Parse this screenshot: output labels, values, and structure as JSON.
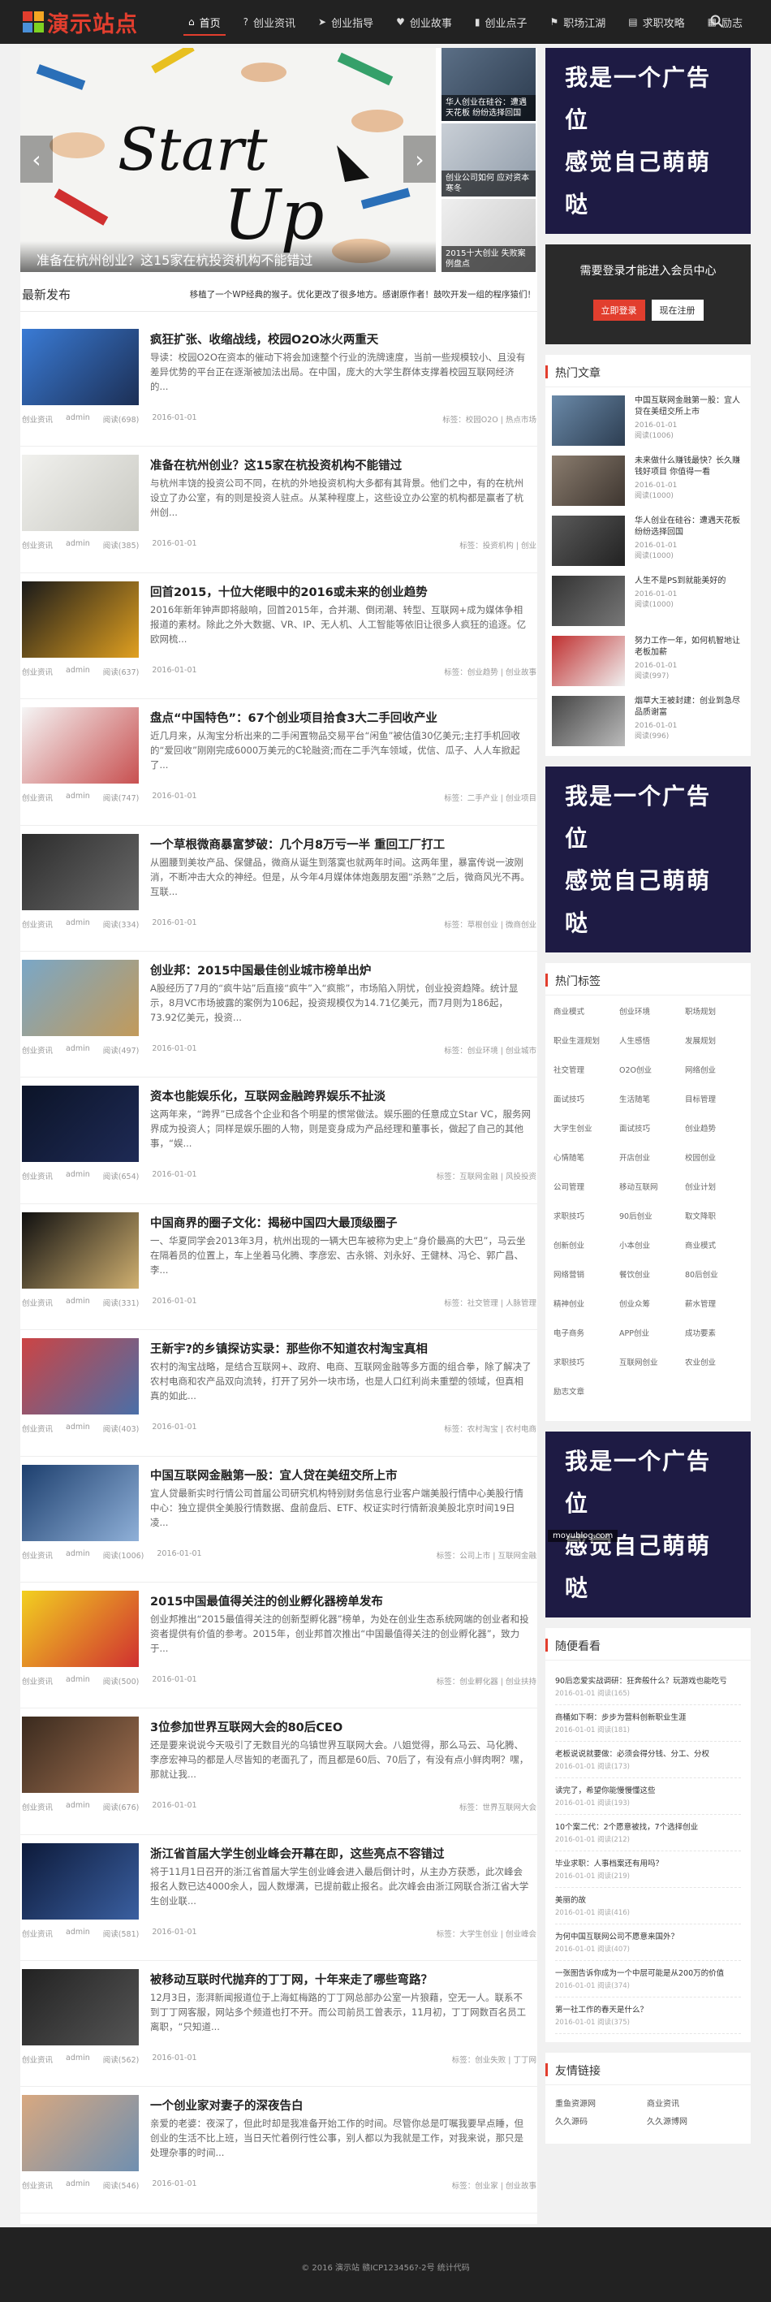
{
  "site": {
    "logo_text": "演示站点",
    "brand_colors": {
      "red": "#e23e2e",
      "orange": "#f5a623",
      "dark": "#222222",
      "ad": "#1e1b44"
    }
  },
  "nav": [
    {
      "label": "首页",
      "icon": "home-icon",
      "glyph": "⌂"
    },
    {
      "label": "创业资讯",
      "icon": "question-icon",
      "glyph": "?"
    },
    {
      "label": "创业指导",
      "icon": "send-icon",
      "glyph": "➤"
    },
    {
      "label": "创业故事",
      "icon": "heart-icon",
      "glyph": "♥"
    },
    {
      "label": "创业点子",
      "icon": "book-icon",
      "glyph": "▮"
    },
    {
      "label": "职场江湖",
      "icon": "flag-icon",
      "glyph": "⚑"
    },
    {
      "label": "求职攻略",
      "icon": "file-icon",
      "glyph": "▤"
    },
    {
      "label": "励志",
      "icon": "grid-icon",
      "glyph": "▦"
    }
  ],
  "search_icon": "search-icon",
  "slider": {
    "caption": "准备在杭州创业？这15家在杭投资机构不能错过",
    "prev": "‹",
    "next": "›",
    "words": {
      "w1": "Start",
      "w2": "Up"
    }
  },
  "thumbs": [
    {
      "caption": "华人创业在硅谷：遭遇天花板 纷纷选择回国"
    },
    {
      "caption": "创业公司如何 应对资本寒冬"
    },
    {
      "caption": "2015十大创业 失败案例盘点"
    }
  ],
  "latest": {
    "title": "最新发布",
    "notice": "移植了一个WP经典的猴子。优化更改了很多地方。感谢原作者！鼓吹开发一组的程序猿们！"
  },
  "posts": [
    {
      "title": "疯狂扩张、收缩战线，校园O2O冰火两重天",
      "excerpt": "导读：校园O2O在资本的催动下将会加速整个行业的洗牌速度，当前一些规模较小、且没有差异优势的平台正在逐渐被加法出局。在中国，庞大的大学生群体支撑着校园互联网经济的...",
      "cat": "创业资讯",
      "author": "admin",
      "views": "阅读(698)",
      "date": "2016-01-01",
      "tags": "标签：校园O2O  |  热点市场"
    },
    {
      "title": "准备在杭州创业？这15家在杭投资机构不能错过",
      "excerpt": "与杭州丰饶的投资公司不同，在杭的外地投资机构大多都有其背景。他们之中，有的在杭州设立了办公室，有的则是投资人驻点。从某种程度上，这些设立办公室的机构都是赢者了杭州创...",
      "cat": "创业资讯",
      "author": "admin",
      "views": "阅读(385)",
      "date": "2016-01-01",
      "tags": "标签：投资机构  |  创业"
    },
    {
      "title": "回首2015，十位大佬眼中的2016或未来的创业趋势",
      "excerpt": "2016年新年钟声即将敲响，回首2015年，合并潮、倒闭潮、转型、互联网+成为媒体争相报道的素材。除此之外大数据、VR、IP、无人机、人工智能等依旧让很多人疯狂的追逐。亿欧网梳...",
      "cat": "创业资讯",
      "author": "admin",
      "views": "阅读(637)",
      "date": "2016-01-01",
      "tags": "标签：创业趋势  |  创业故事"
    },
    {
      "title": "盘点“中国特色”：67个创业项目拾食3大二手回收产业",
      "excerpt": "近几月来，从淘宝分析出来的二手闲置物品交易平台“闲鱼”被估值30亿美元;主打手机回收的“爱回收”刚刚完成6000万美元的C轮融资;而在二手汽车领域，优信、瓜子、人人车掀起了...",
      "cat": "创业资讯",
      "author": "admin",
      "views": "阅读(747)",
      "date": "2016-01-01",
      "tags": "标签：二手产业  |  创业项目"
    },
    {
      "title": "一个草根微商暴富梦破：几个月8万亏一半 重回工厂打工",
      "excerpt": "从圈腰到美妆产品、保健品，微商从诞生到落寞也就两年时间。这两年里，暴富传说一波刚消，不断冲击大众的神经。但是，从今年4月媒体体炮轰朋友圈“杀熟”之后，微商风光不再。互联...",
      "cat": "创业资讯",
      "author": "admin",
      "views": "阅读(334)",
      "date": "2016-01-01",
      "tags": "标签：草根创业  |  微商创业"
    },
    {
      "title": "创业邦：2015中国最佳创业城市榜单出炉",
      "excerpt": "A股经历了7月的“疯牛站”后直接“疯牛”入“疯熊”，市场陷入阴忧，创业投资趋降。统计显示，8月VC市场披露的案例为106起，投资规模仅为14.71亿美元，而7月则为186起，73.92亿美元，投资...",
      "cat": "创业资讯",
      "author": "admin",
      "views": "阅读(497)",
      "date": "2016-01-01",
      "tags": "标签：创业环境  |  创业城市"
    },
    {
      "title": "资本也能娱乐化，互联网金融跨界娱乐不扯淡",
      "excerpt": "这两年来，“跨界”已成各个企业和各个明星的惯常做法。娱乐圈的任意成立Star VC，服务网界成为投资人；同样是娱乐圈的人物，则是变身成为产品经理和董事长，做起了自己的其他事，“娱...",
      "cat": "创业资讯",
      "author": "admin",
      "views": "阅读(654)",
      "date": "2016-01-01",
      "tags": "标签：互联网金融  |  风投投资"
    },
    {
      "title": "中国商界的圈子文化：揭秘中国四大最顶级圈子",
      "excerpt": "一、华夏同学会2013年3月，杭州出现的一辆大巴车被称为史上“身价最高的大巴”，马云坐在隔着员的位置上，车上坐着马化腾、李彦宏、古永锵、刘永好、王健林、冯仑、郭广昌、李...",
      "cat": "创业资讯",
      "author": "admin",
      "views": "阅读(331)",
      "date": "2016-01-01",
      "tags": "标签：社交管理  |  人脉管理"
    },
    {
      "title": "王新宇?的乡镇探访实录：那些你不知道农村淘宝真相",
      "excerpt": "农村的淘宝战略，是结合互联网+、政府、电商、互联网金融等多方面的组合拳，除了解决了农村电商和农产品双向流转，打开了另外一块市场，也是人口红利尚未重塑的领域，但真相真的如此...",
      "cat": "创业资讯",
      "author": "admin",
      "views": "阅读(403)",
      "date": "2016-01-01",
      "tags": "标签：农村淘宝  |  农村电商"
    },
    {
      "title": "中国互联网金融第一股：宜人贷在美纽交所上市",
      "excerpt": "宜人贷最新实时行情公司首届公司研究机构特别财务信息行业客户端美股行情中心美股行情中心：独立提供全美股行情数据、盘前盘后、ETF、权证实时行情新浪美股北京时间19日凌...",
      "cat": "创业资讯",
      "author": "admin",
      "views": "阅读(1006)",
      "date": "2016-01-01",
      "tags": "标签：公司上市  |  互联网金融"
    },
    {
      "title": "2015中国最值得关注的创业孵化器榜单发布",
      "excerpt": "创业邦推出“2015最值得关注的创新型孵化器”榜单，为处在创业生态系统网端的创业者和投资者提供有价值的参考。2015年，创业邦首次推出“中国最值得关注的创业孵化器”，致力于...",
      "cat": "创业资讯",
      "author": "admin",
      "views": "阅读(500)",
      "date": "2016-01-01",
      "tags": "标签：创业孵化器  |  创业扶持"
    },
    {
      "title": "3位参加世界互联网大会的80后CEO",
      "excerpt": "还是要来说说今天吸引了无数目光的乌镇世界互联网大会。八姐觉得，那么马云、马化腾、李彦宏神马的都是人尽皆知的老面孔了，而且都是60后、70后了，有没有点小鲜肉啊？嘿，那就让我...",
      "cat": "创业资讯",
      "author": "admin",
      "views": "阅读(676)",
      "date": "2016-01-01",
      "tags": "标签：世界互联网大会"
    },
    {
      "title": "浙江省首届大学生创业峰会开幕在即，这些亮点不容错过",
      "excerpt": "将于11月1日召开的浙江省首届大学生创业峰会进入最后倒计时，从主办方获悉，此次峰会报名人数已达4000余人，园人数爆满，已提前截止报名。此次峰会由浙江网联合浙江省大学生创业联...",
      "cat": "创业资讯",
      "author": "admin",
      "views": "阅读(581)",
      "date": "2016-01-01",
      "tags": "标签：大学生创业  |  创业峰会"
    },
    {
      "title": "被移动互联时代抛弃的丁丁网，十年来走了哪些弯路？",
      "excerpt": "12月3日，澎湃新闻报道位于上海虹梅路的丁丁网总部办公室一片狼藉，空无一人。联系不到丁丁网客服，网站多个频道也打不开。而公司前员工曾表示，11月初，丁丁网数百名员工离职，“只知道...",
      "cat": "创业资讯",
      "author": "admin",
      "views": "阅读(562)",
      "date": "2016-01-01",
      "tags": "标签：创业失败  |  丁丁网"
    },
    {
      "title": "一个创业家对妻子的深夜告白",
      "excerpt": "亲爱的老婆：夜深了，但此时却是我准备开始工作的时间。尽管你总是叮嘱我要早点睡，但创业的生活不比上班，当日天忙着例行性公事，别人都以为我就是工作，对我来说，那只是处理杂事的时间...",
      "cat": "创业资讯",
      "author": "admin",
      "views": "阅读(546)",
      "date": "2016-01-01",
      "tags": "标签：创业家  |  创业故事"
    }
  ],
  "ads": [
    {
      "line1": "我是一个广告位",
      "line2": "感觉自己萌萌哒"
    },
    {
      "line1": "我是一个广告位",
      "line2": "感觉自己萌萌哒"
    },
    {
      "line1": "我是一个广告位",
      "line2": "感觉自己萌萌哒"
    }
  ],
  "login": {
    "text": "需要登录才能进入会员中心",
    "login_btn": "立即登录",
    "register_btn": "现在注册"
  },
  "hot": {
    "title": "热门文章",
    "items": [
      {
        "title": "中国互联网金融第一股：宜人贷在美纽交所上市",
        "date": "2016-01-01",
        "views": "阅读(1006)"
      },
      {
        "title": "未来做什么赚钱最快？长久赚钱好项目 你值得一看",
        "date": "2016-01-01",
        "views": "阅读(1000)"
      },
      {
        "title": "华人创业在硅谷：遭遇天花板纷纷选择回国",
        "date": "2016-01-01",
        "views": "阅读(1000)"
      },
      {
        "title": "人生不是PS到就能美好的",
        "date": "2016-01-01",
        "views": "阅读(1000)"
      },
      {
        "title": "努力工作一年，如何机智地让老板加薪",
        "date": "2016-01-01",
        "views": "阅读(997)"
      },
      {
        "title": "烟草大王被封建：创业到急尽品质谢富",
        "date": "2016-01-01",
        "views": "阅读(996)"
      }
    ]
  },
  "tags": {
    "title": "热门标签",
    "items": [
      "商业模式",
      "创业环境",
      "职场规划",
      "职业生涯规划",
      "人生感悟",
      "发展规划",
      "社交管理",
      "O2O创业",
      "网络创业",
      "面试技巧",
      "生活随笔",
      "目标管理",
      "大学生创业",
      "面试技巧",
      "创业趋势",
      "心情随笔",
      "开店创业",
      "校园创业",
      "公司管理",
      "移动互联网",
      "创业计划",
      "求职技巧",
      "90后创业",
      "取文降职",
      "创新创业",
      "小本创业",
      "商业模式",
      "网络营销",
      "餐饮创业",
      "80后创业",
      "精神创业",
      "创业众筹",
      "薪水管理",
      "电子商务",
      "APP创业",
      "成功要素",
      "求职技巧",
      "互联网创业",
      "农业创业",
      "励志文章"
    ]
  },
  "follow": {
    "title": "随便看看",
    "items": [
      {
        "title": "90后恋爱实战调研：狂奔般什么？玩游戏也能吃亏",
        "date": "2016-01-01",
        "views": "阅读(165)"
      },
      {
        "title": "商桶如下啊：步步为营料创新职业生涯",
        "date": "2016-01-01",
        "views": "阅读(181)"
      },
      {
        "title": "老板说说就要做：必须会得分钱、分工、分权",
        "date": "2016-01-01",
        "views": "阅读(173)"
      },
      {
        "title": "读完了，希望你能慢慢懂这些",
        "date": "2016-01-01",
        "views": "阅读(193)"
      },
      {
        "title": "10个案二代：2个愿意被找，7个选择创业",
        "date": "2016-01-01",
        "views": "阅读(212)"
      },
      {
        "title": "毕业求职：人事档案还有用吗？",
        "date": "2016-01-01",
        "views": "阅读(219)"
      },
      {
        "title": "美丽的故",
        "date": "2016-01-01",
        "views": "阅读(416)"
      },
      {
        "title": "为何中国互联网公司不愿意来国外？",
        "date": "2016-01-01",
        "views": "阅读(407)"
      },
      {
        "title": "一张图告诉你成为一个中层可能是从200万的价值",
        "date": "2016-01-01",
        "views": "阅读(374)"
      },
      {
        "title": "第一社工作的春天是什么？",
        "date": "2016-01-01",
        "views": "阅读(375)"
      }
    ]
  },
  "links": {
    "title": "友情链接",
    "items": [
      "重鱼资源网",
      "商业资讯",
      "久久源码",
      "久久源博网"
    ]
  },
  "watermark": "moyublog.com",
  "footer": {
    "text": "© 2016 演示站   赣ICP123456?-2号   统计代码"
  }
}
